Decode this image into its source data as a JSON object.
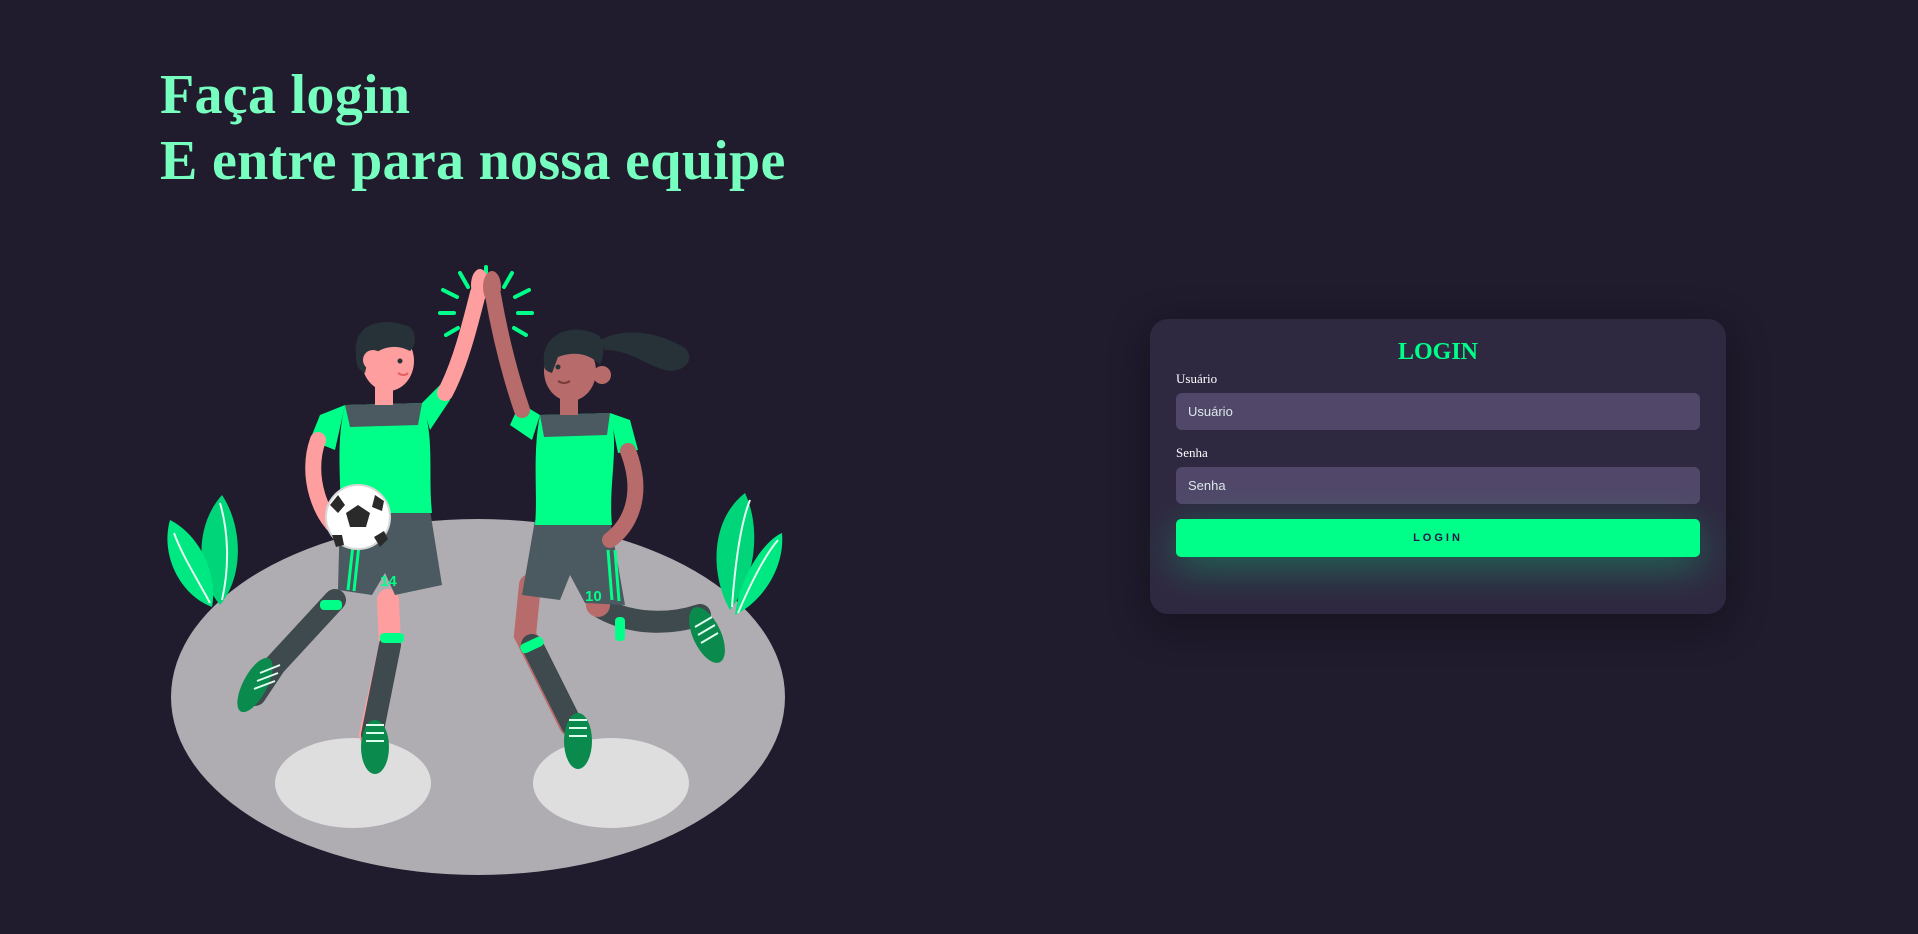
{
  "left": {
    "headline_line1": "Faça login",
    "headline_line2": "E entre para nossa equipe"
  },
  "illustration": {
    "left_player_number": "14",
    "right_player_number": "10"
  },
  "card": {
    "title": "LOGIN",
    "username_label": "Usuário",
    "username_placeholder": "Usuário",
    "username_value": "",
    "password_label": "Senha",
    "password_placeholder": "Senha",
    "password_value": "",
    "button_label": "Login"
  },
  "colors": {
    "background": "#201b2d",
    "accent": "#00ff88",
    "headline": "#77ffc0",
    "card": "#2f2841",
    "input": "#514869"
  }
}
